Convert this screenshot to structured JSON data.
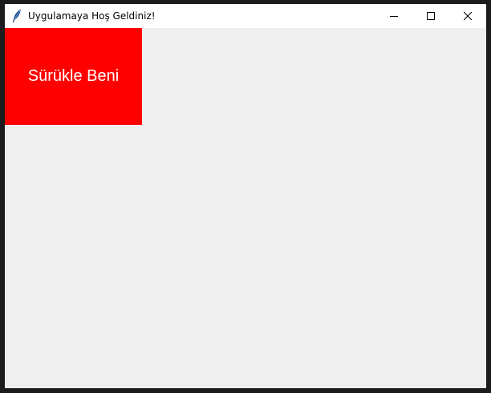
{
  "window": {
    "title": "Uygulamaya Hoş Geldiniz!",
    "icon": "feather-icon",
    "controls": {
      "minimize_icon": "minimize-icon",
      "maximize_icon": "maximize-icon",
      "close_icon": "close-icon"
    },
    "background_color": "#efefef"
  },
  "drag_box": {
    "label": "Sürükle Beni",
    "color": "#ff0000",
    "text_color": "#ffffff"
  }
}
